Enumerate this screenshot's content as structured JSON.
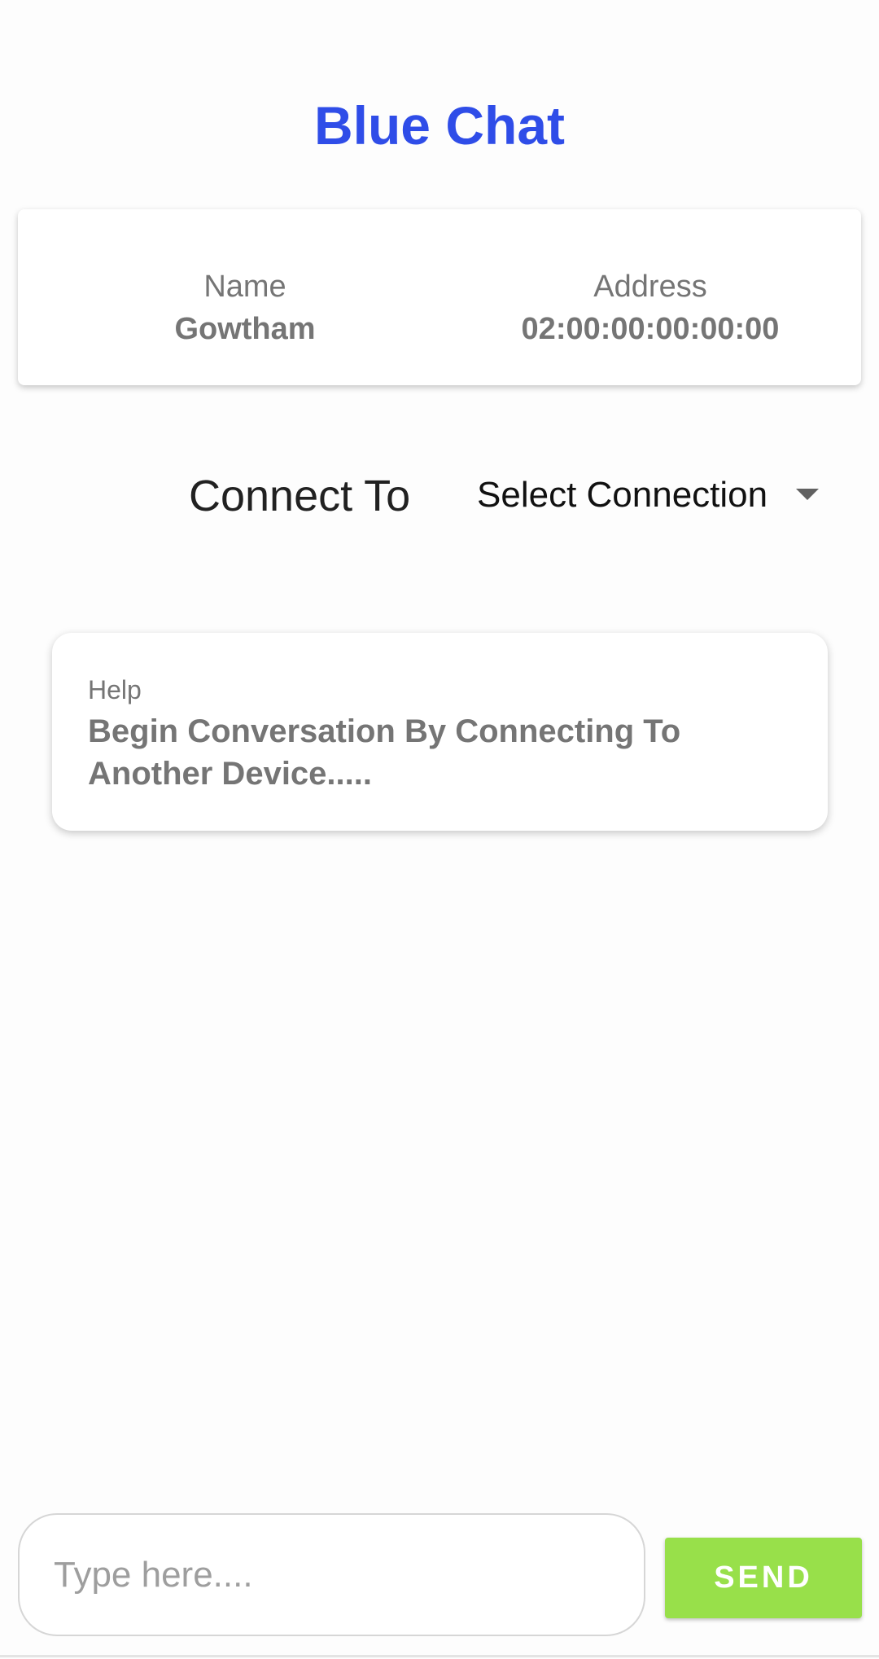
{
  "app": {
    "title": "Blue Chat"
  },
  "device_info": {
    "name_label": "Name",
    "name_value": "Gowtham",
    "address_label": "Address",
    "address_value": "02:00:00:00:00:00"
  },
  "connect": {
    "label": "Connect To",
    "selected": "Select Connection",
    "dropdown_icon": "triangle-down"
  },
  "help": {
    "title": "Help",
    "message": "Begin Conversation By Connecting To Another Device....."
  },
  "composer": {
    "input_value": "",
    "placeholder": "Type here....",
    "send_label": "SEND"
  },
  "colors": {
    "title": "#2f4de8",
    "send_button": "#98e04a",
    "background": "#fdfdfd"
  }
}
